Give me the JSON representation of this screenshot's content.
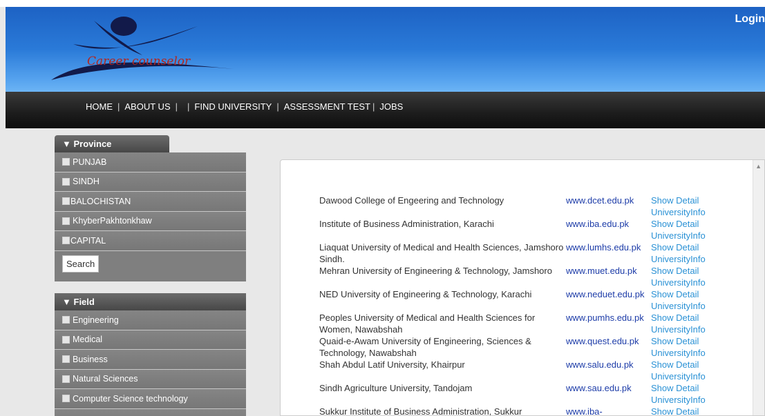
{
  "header": {
    "logo_text": "Career counselor",
    "login_label": "Login"
  },
  "nav": {
    "items": [
      "HOME",
      "ABOUT US",
      "FIND UNIVERSITY",
      "ASSESSMENT TEST",
      "JOBS"
    ],
    "separators": [
      "|",
      "|",
      "|",
      "|",
      "|"
    ]
  },
  "province": {
    "title": "Province",
    "items": [
      "PUNJAB",
      "SINDH",
      "BALOCHISTAN",
      "KhyberPakhtonkhaw",
      "CAPITAL"
    ],
    "search_label": "Search"
  },
  "field": {
    "title": "Field",
    "items": [
      "Engineering",
      "Medical",
      "Business",
      "Natural Sciences",
      "Computer Science technology"
    ]
  },
  "universities": {
    "show_detail_label": "Show Detail",
    "info_label": "UniversityInfo",
    "rows": [
      {
        "name": "Dawood College of Engeering and Technology",
        "url": "www.dcet.edu.pk"
      },
      {
        "name": "Institute of Business Administration, Karachi",
        "url": "www.iba.edu.pk"
      },
      {
        "name": "Liaquat University of Medical and Health Sciences, Jamshoro Sindh.",
        "url": "www.lumhs.edu.pk"
      },
      {
        "name": "Mehran University of Engineering & Technology, Jamshoro",
        "url": "www.muet.edu.pk"
      },
      {
        "name": "NED University of Engineering & Technology, Karachi",
        "url": "www.neduet.edu.pk"
      },
      {
        "name": "Peoples University of Medical and Health Sciences for Women, Nawabshah",
        "url": "www.pumhs.edu.pk"
      },
      {
        "name": "Quaid-e-Awam University of Engineering, Sciences & Technology, Nawabshah",
        "url": "www.quest.edu.pk"
      },
      {
        "name": "Shah Abdul Latif University, Khairpur",
        "url": "www.salu.edu.pk"
      },
      {
        "name": "Sindh Agriculture University, Tandojam",
        "url": "www.sau.edu.pk"
      },
      {
        "name": "Sukkur Institute of Business Administration, Sukkur",
        "url": "www.iba-"
      }
    ]
  },
  "colors": {
    "header_blue": "#2a7ad8",
    "nav_dark": "#1c1c1c",
    "link_blue": "#2a91d5",
    "url_blue": "#1d3ca8"
  }
}
